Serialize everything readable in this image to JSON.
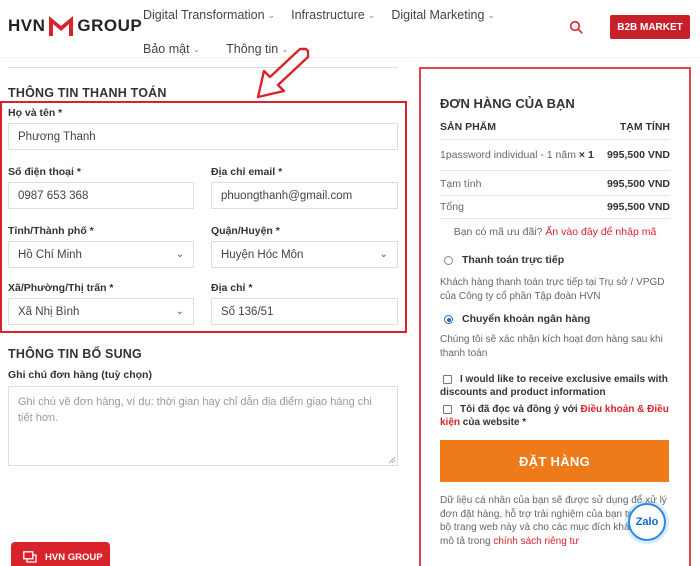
{
  "header": {
    "logo_left": "HVN",
    "logo_right": "GROUP",
    "nav": [
      {
        "label": "Digital Transformation"
      },
      {
        "label": "Infrastructure"
      },
      {
        "label": "Digital Marketing"
      },
      {
        "label": "Bảo mật"
      },
      {
        "label": "Thông tin"
      }
    ],
    "chevron": "⌄",
    "b2b_label": "B2B MARKET"
  },
  "billing": {
    "title": "THÔNG TIN THANH TOÁN",
    "name_label": "Họ và tên *",
    "name_value": "Phương Thanh",
    "phone_label": "Số điện thoại *",
    "phone_value": "0987 653 368",
    "email_label": "Địa chỉ email *",
    "email_value": "phuongthanh@gmail.com",
    "city_label": "Tỉnh/Thành phố *",
    "city_value": "Hồ Chí Minh",
    "district_label": "Quận/Huyện *",
    "district_value": "Huyện Hóc Môn",
    "ward_label": "Xã/Phường/Thị trấn *",
    "ward_value": "Xã Nhị Bình",
    "address_label": "Địa chỉ *",
    "address_value": "Số 136/51"
  },
  "extra": {
    "title": "THÔNG TIN BỔ SUNG",
    "notes_label": "Ghi chú đơn hàng (tuỳ chọn)",
    "notes_placeholder": "Ghi chú về đơn hàng, ví dụ: thời gian hay chỉ dẫn địa điểm giao hàng chi tiết hơn."
  },
  "chat_button": "HVN GROUP",
  "order": {
    "title": "ĐƠN HÀNG CỦA BẠN",
    "col_product": "SẢN PHẨM",
    "col_subtotal": "TẠM TÍNH",
    "item_name": "1password individual - 1 năm",
    "item_qty": "× 1",
    "item_price": "995,500 VND",
    "subtotal_label": "Tạm tính",
    "subtotal_value": "995,500 VND",
    "total_label": "Tổng",
    "total_value": "995,500 VND",
    "coupon_text": "Bạn có mã ưu đãi?",
    "coupon_link": "Ấn vào đây để nhập mã",
    "pay_direct_label": "Thanh toán trực tiếp",
    "pay_direct_desc": "Khách hàng thanh toán trực tiếp tại Trụ sở / VPGD của Công ty cổ phần Tập đoàn HVN",
    "pay_bank_label": "Chuyển khoản ngân hàng",
    "pay_bank_desc": "Chúng tôi sẽ xác nhận kích hoạt đơn hàng sau khi thanh toán",
    "emails_label": "I would like to receive exclusive emails with discounts and product information",
    "terms_prefix": "Tôi đã đọc và đồng ý với",
    "terms_link": "Điều khoản & Điều kiện",
    "terms_suffix": "của website *",
    "place_order": "ĐẶT HÀNG",
    "privacy_text": "Dữ liệu cá nhân của bạn sẽ được sử dụng để xử lý đơn đặt hàng, hỗ trợ trải nghiệm của bạn trên toàn bộ trang web này và cho các mục đích khác được mô tả trong",
    "privacy_link": "chính sách riêng tư",
    "zalo": "Zalo"
  }
}
